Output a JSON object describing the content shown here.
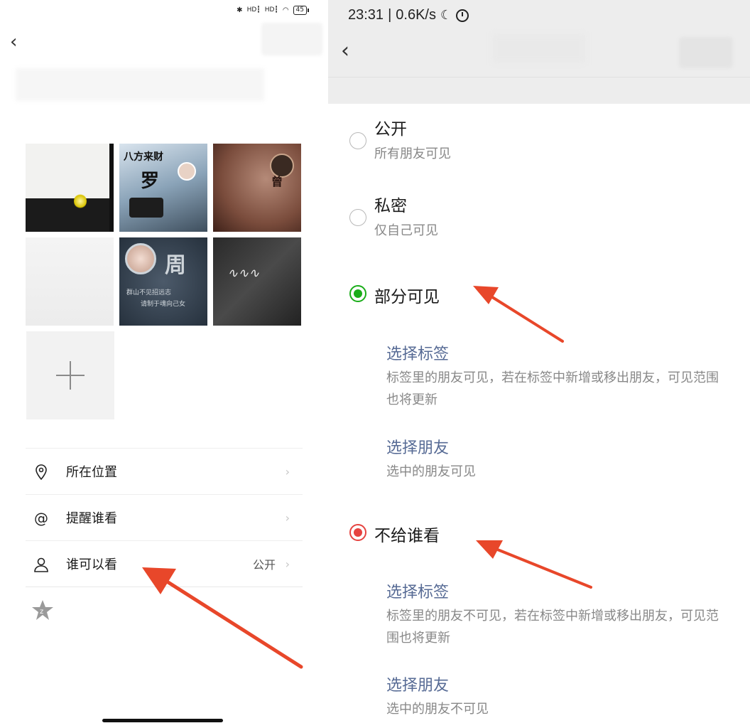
{
  "left": {
    "status": {
      "signal1": "HD┇",
      "signal2": "HD┇",
      "battery": "45"
    },
    "add_label": "+",
    "menu": [
      {
        "label": "所在位置",
        "value": ""
      },
      {
        "label": "提醒谁看",
        "value": ""
      },
      {
        "label": "谁可以看",
        "value": "公开"
      }
    ],
    "tile_text": {
      "t2_a": "八方来财",
      "t2_b": "罗",
      "t3_b": "曾",
      "t5_b": "周",
      "t5_l1": "群山不见招远志",
      "t5_l2": "请制于魂向己女"
    }
  },
  "right": {
    "status": {
      "time": "23:31",
      "speed": "0.6K/s"
    },
    "options": [
      {
        "title": "公开",
        "desc": "所有朋友可见"
      },
      {
        "title": "私密",
        "desc": "仅自己可见"
      },
      {
        "title": "部分可见",
        "desc": ""
      },
      {
        "title": "不给谁看",
        "desc": ""
      }
    ],
    "partial_subs": [
      {
        "title": "选择标签",
        "desc": "标签里的朋友可见，若在标签中新增或移出朋友，可见范围也将更新"
      },
      {
        "title": "选择朋友",
        "desc": "选中的朋友可见"
      }
    ],
    "exclude_subs": [
      {
        "title": "选择标签",
        "desc": "标签里的朋友不可见，若在标签中新增或移出朋友，可见范围也将更新"
      },
      {
        "title": "选择朋友",
        "desc": "选中的朋友不可见"
      }
    ]
  },
  "colors": {
    "accent_green": "#1aad19",
    "accent_red": "#e64340",
    "link_blue": "#576b95",
    "arrow": "#e8472a"
  }
}
